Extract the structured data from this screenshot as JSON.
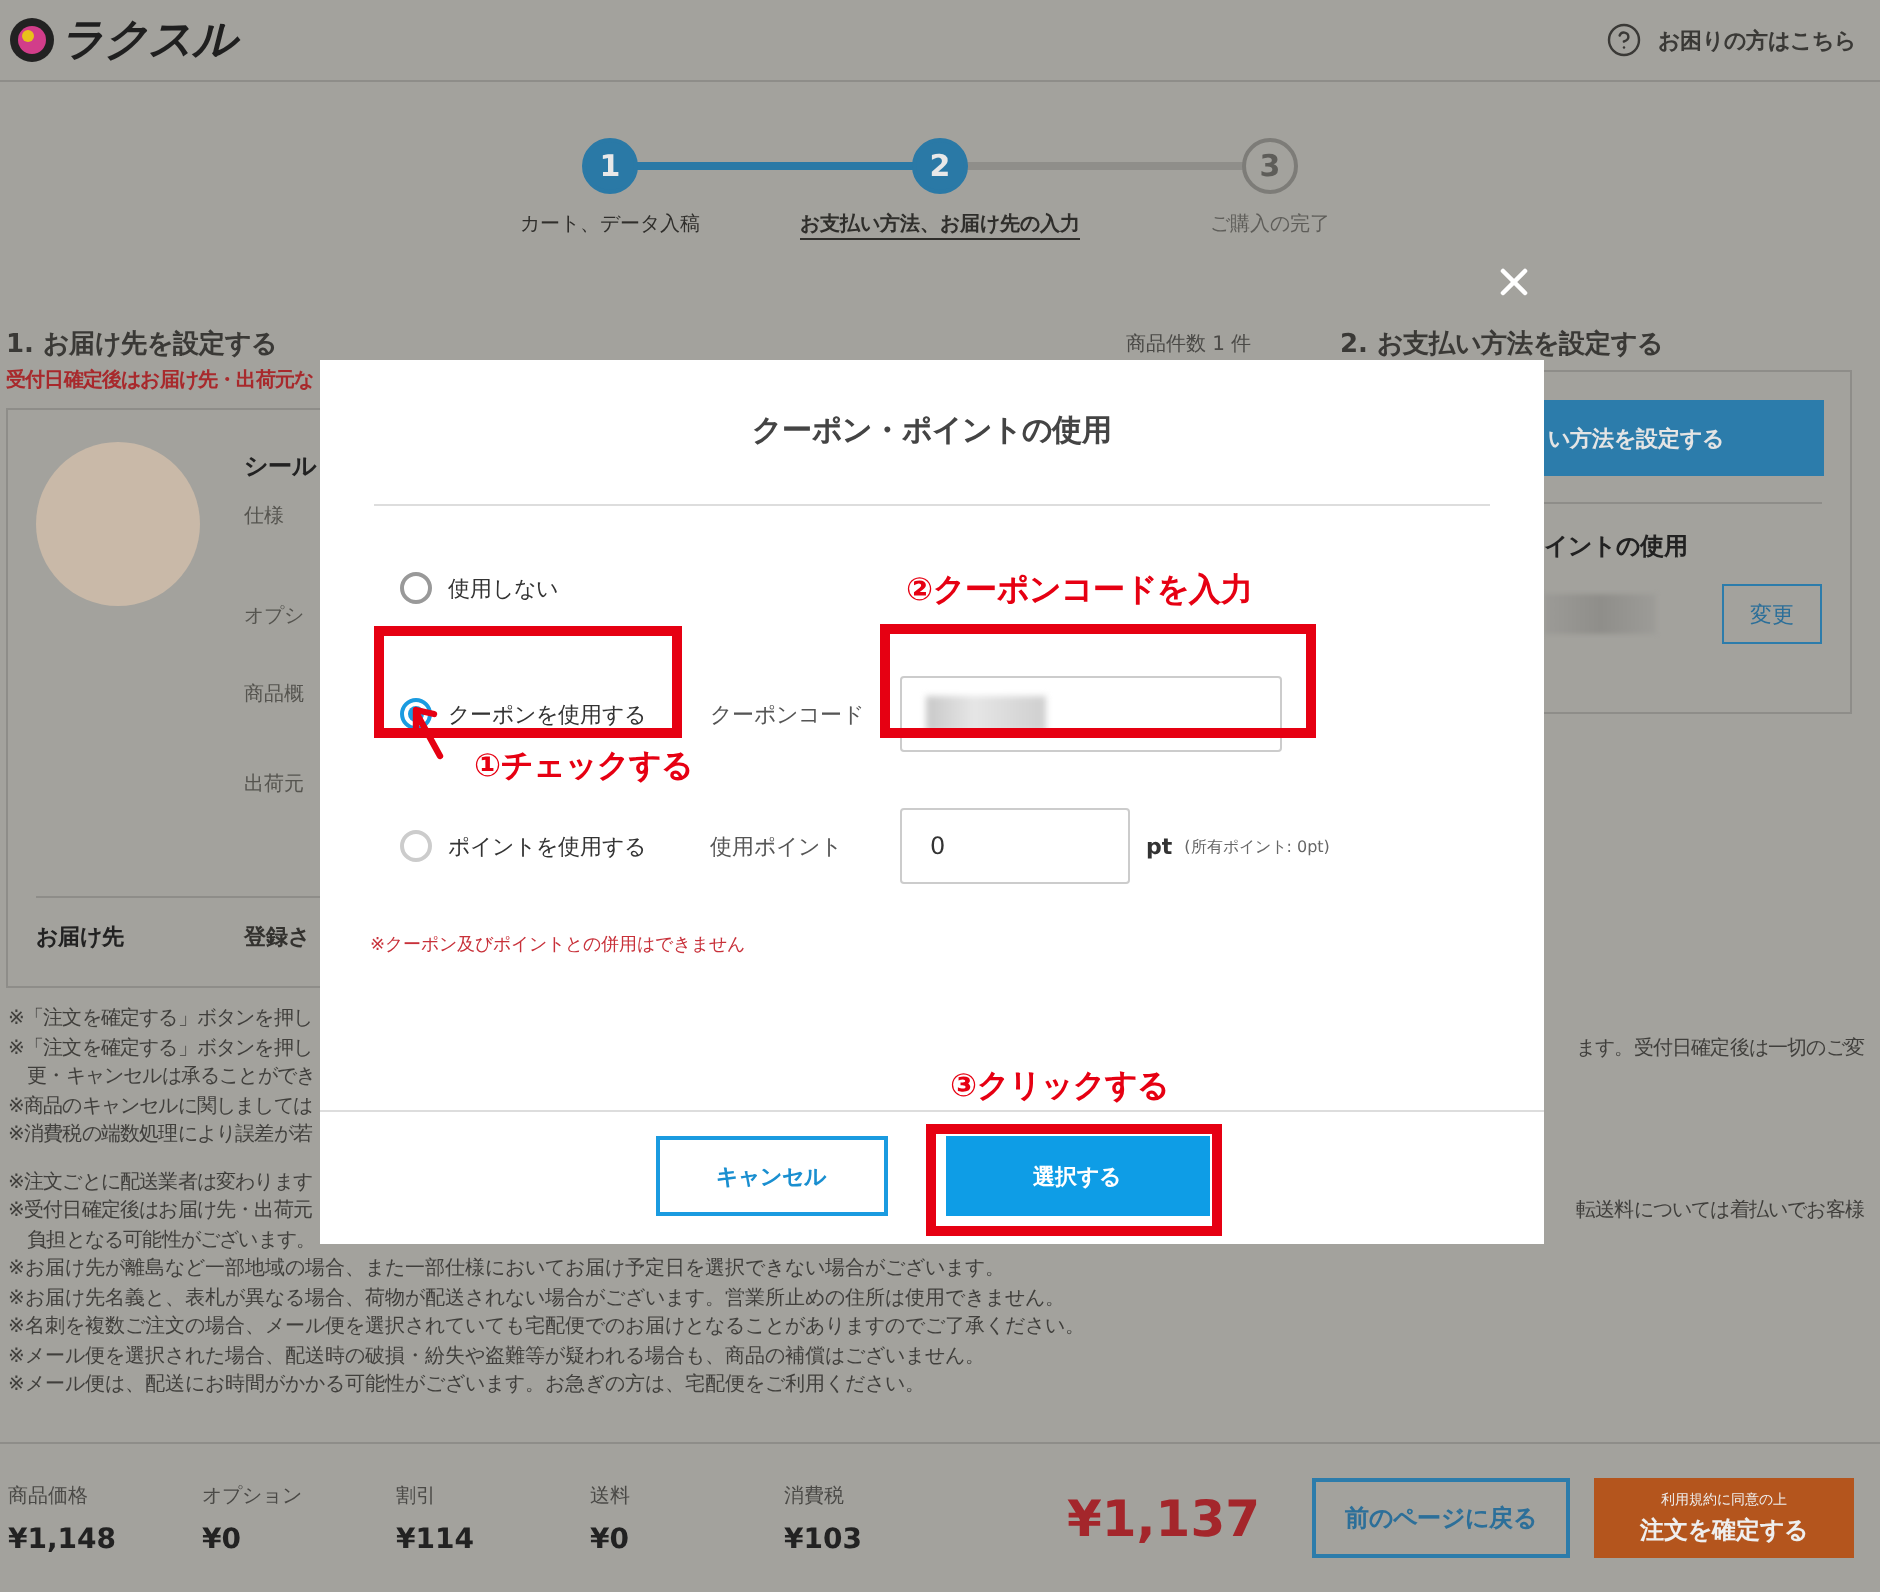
{
  "header": {
    "logo": "ラクスル",
    "help": "お困りの方はこちら"
  },
  "steps": [
    {
      "number": "1",
      "label": "カート、データ入稿",
      "reached": true,
      "selected": false
    },
    {
      "number": "2",
      "label": "お支払い方法、お届け先の入力",
      "reached": true,
      "selected": true
    },
    {
      "number": "3",
      "label": "ご購入の完了",
      "reached": false,
      "selected": false
    }
  ],
  "delivery": {
    "title": "1. お届け先を設定する",
    "warning": "受付日確定後はお届け先・出荷元な",
    "product_name": "シール",
    "spec_labels": [
      "仕様",
      "オプシ",
      "商品概",
      "出荷元"
    ],
    "address_label": "お届け先",
    "address_value": "登録さ"
  },
  "item_count": "商品件数 1 件",
  "payment": {
    "title": "2. お支払い方法を設定する",
    "button": "い方法を設定する",
    "points_title": "イントの使用",
    "change_button": "変更"
  },
  "notes_split": [
    {
      "left": "※「注文を確定する」ボタンを押し"
    },
    {
      "left": "※「注文を確定する」ボタンを押し",
      "right": "ます。受付日確定後は一切のご変"
    },
    {
      "left": "　更・キャンセルは承ることができ"
    },
    {
      "left": "※商品のキャンセルに関しましては"
    },
    {
      "left": "※消費税の端数処理により誤差が若"
    },
    {
      "left": "※注文ごとに配送業者は変わります"
    },
    {
      "left": "※受付日確定後はお届け先・出荷元",
      "right": "転送料については着払いでお客様"
    },
    {
      "left": "　負担となる可能性がございます。"
    }
  ],
  "notes": [
    "※お届け先が離島など一部地域の場合、また一部仕様においてお届け予定日を選択できない場合がございます。",
    "※お届け先名義と、表札が異なる場合、荷物が配送されない場合がございます。営業所止めの住所は使用できません。",
    "※名刺を複数ご注文の場合、メール便を選択されていても宅配便でのお届けとなることがありますのでご了承ください。",
    "※メール便を選択された場合、配送時の破損・紛失や盗難等が疑われる場合も、商品の補償はございません。",
    "※メール便は、配送にお時間がかかる可能性がございます。お急ぎの方は、宅配便をご利用ください。"
  ],
  "footer": {
    "summary": [
      {
        "label": "商品価格",
        "value": "¥1,148"
      },
      {
        "label": "オプション",
        "value": "¥0"
      },
      {
        "label": "割引",
        "value": "¥114"
      },
      {
        "label": "送料",
        "value": "¥0"
      },
      {
        "label": "消費税",
        "value": "¥103"
      }
    ],
    "total": "¥1,137",
    "back_button": "前のページに戻る",
    "confirm_note": "利用規約に同意の上",
    "confirm_button": "注文を確定する"
  },
  "modal": {
    "title": "クーポン・ポイントの使用",
    "options": [
      {
        "kind": "none",
        "label": "使用しない",
        "selected": false
      },
      {
        "kind": "code",
        "label": "クーポンを使用する",
        "selected": true,
        "field_label": "クーポンコード"
      },
      {
        "kind": "points",
        "label": "ポイントを使用する",
        "selected": false,
        "field_label": "使用ポイント",
        "value": "0",
        "unit": "pt",
        "hint": "(所有ポイント: 0pt)"
      }
    ],
    "warning": "※クーポン及びポイントとの併用はできません",
    "cancel": "キャンセル",
    "submit": "選択する"
  },
  "annotations": [
    {
      "kind": "check",
      "text": "①チェックする"
    },
    {
      "kind": "input",
      "text": "②クーポンコードを入力"
    },
    {
      "kind": "click",
      "text": "③クリックする"
    }
  ]
}
